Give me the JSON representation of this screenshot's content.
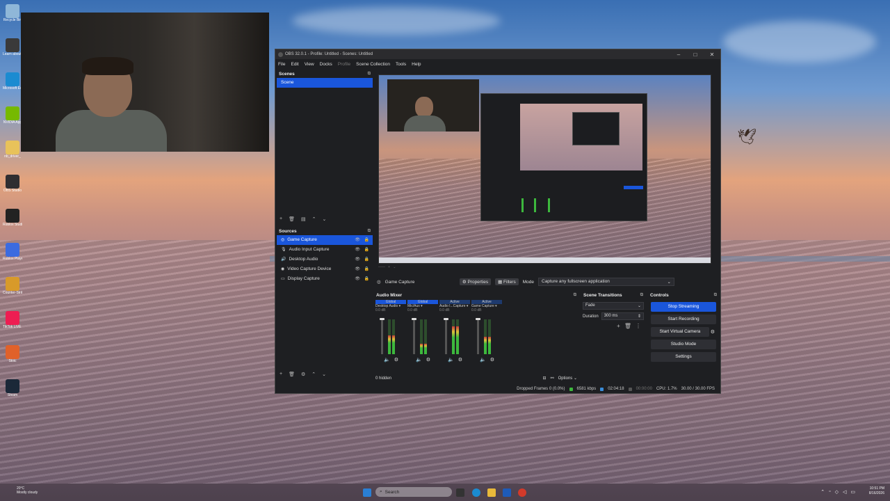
{
  "desktop": {
    "icons": [
      {
        "label": "Recycle Bin",
        "color": "#8fb7d8"
      },
      {
        "label": "Learn about this picture",
        "color": "#3a3a3a"
      },
      {
        "label": "Microsoft Edge",
        "color": "#1b8bd1"
      },
      {
        "label": "NVIDIA App",
        "color": "#76b900"
      },
      {
        "label": "nb_driver_",
        "color": "#e8c25a"
      },
      {
        "label": "OBS Studio",
        "color": "#302e31"
      },
      {
        "label": "Roblox Studio",
        "color": "#222222"
      },
      {
        "label": "Roblox Player",
        "color": "#3b6be0"
      },
      {
        "label": "Counter-Strike",
        "color": "#d89a2a"
      },
      {
        "label": "TikTok LIVE Studio",
        "color": "#ee1d52"
      },
      {
        "label": "Stoic",
        "color": "#e0612a"
      },
      {
        "label": "Steam",
        "color": "#1b2838"
      }
    ]
  },
  "obs": {
    "title": "OBS 32.0.1 - Profile: Untitled - Scenes: Untitled",
    "window_controls": {
      "minimize": "–",
      "maximize": "□",
      "close": "✕"
    },
    "menu": [
      "File",
      "Edit",
      "View",
      "Docks",
      "Profile",
      "Scene Collection",
      "Tools",
      "Help"
    ],
    "scenes": {
      "header": "Scenes",
      "items": [
        "Scene"
      ],
      "toolbar": [
        "+",
        "🗑",
        "▤",
        "⌃",
        "⌄"
      ]
    },
    "sources": {
      "header": "Sources",
      "items": [
        {
          "label": "Game Capture",
          "icon": "game-capture-icon",
          "glyph": "◎"
        },
        {
          "label": "Audio Input Capture",
          "icon": "microphone-icon",
          "glyph": "🎙"
        },
        {
          "label": "Desktop Audio",
          "icon": "speaker-icon",
          "glyph": "🔊"
        },
        {
          "label": "Video Capture Device",
          "icon": "camera-icon",
          "glyph": "◉"
        },
        {
          "label": "Display Capture",
          "icon": "display-icon",
          "glyph": "▭"
        }
      ],
      "toolbar": [
        "+",
        "🗑",
        "⚙",
        "⌃",
        "⌄"
      ]
    },
    "source_bar": {
      "current_source": "Game Capture",
      "properties": "Properties",
      "filters": "Filters",
      "mode_label": "Mode",
      "mode_value": "Capture any fullscreen application"
    },
    "audio_mixer": {
      "header": "Audio Mixer",
      "channels": [
        {
          "badge": "Global",
          "name": "Desktop Audio",
          "level": 0.55,
          "db": "0.0 dB",
          "fader": 0.0
        },
        {
          "badge": "Global",
          "name": "Mic/Aux",
          "level": 0.3,
          "db": "0.0 dB",
          "fader": 0.0
        },
        {
          "badge": "Active",
          "name": "Audio I...Capture",
          "level": 0.8,
          "db": "0.0 dB",
          "fader": 0.0
        },
        {
          "badge": "Active",
          "name": "Game Capture",
          "level": 0.5,
          "db": "0.0 dB",
          "fader": 0.0
        }
      ],
      "hidden": "0 hidden",
      "options": "Options"
    },
    "scene_transitions": {
      "header": "Scene Transitions",
      "transition": "Fade",
      "duration_label": "Duration",
      "duration_value": "300 ms"
    },
    "controls": {
      "header": "Controls",
      "buttons": [
        "Stop Streaming",
        "Start Recording",
        "Start Virtual Camera",
        "Studio Mode",
        "Settings"
      ]
    },
    "status": {
      "dropped_frames": "Dropped Frames 0 (0.0%)",
      "bitrate": "6581 kbps",
      "stream_time": "02:04:18",
      "rec_time": "00:00:00",
      "cpu": "CPU: 1.7%",
      "fps": "30.00 / 30.00 FPS"
    }
  },
  "taskbar": {
    "weather_temp": "20°C",
    "weather_desc": "Mostly cloudy",
    "search_placeholder": "Search",
    "time": "10:51 PM",
    "date": "8/16/2026"
  },
  "colors": {
    "accent": "#1a56db",
    "panel": "#1e1f22",
    "meter_green": "#3db83d"
  }
}
